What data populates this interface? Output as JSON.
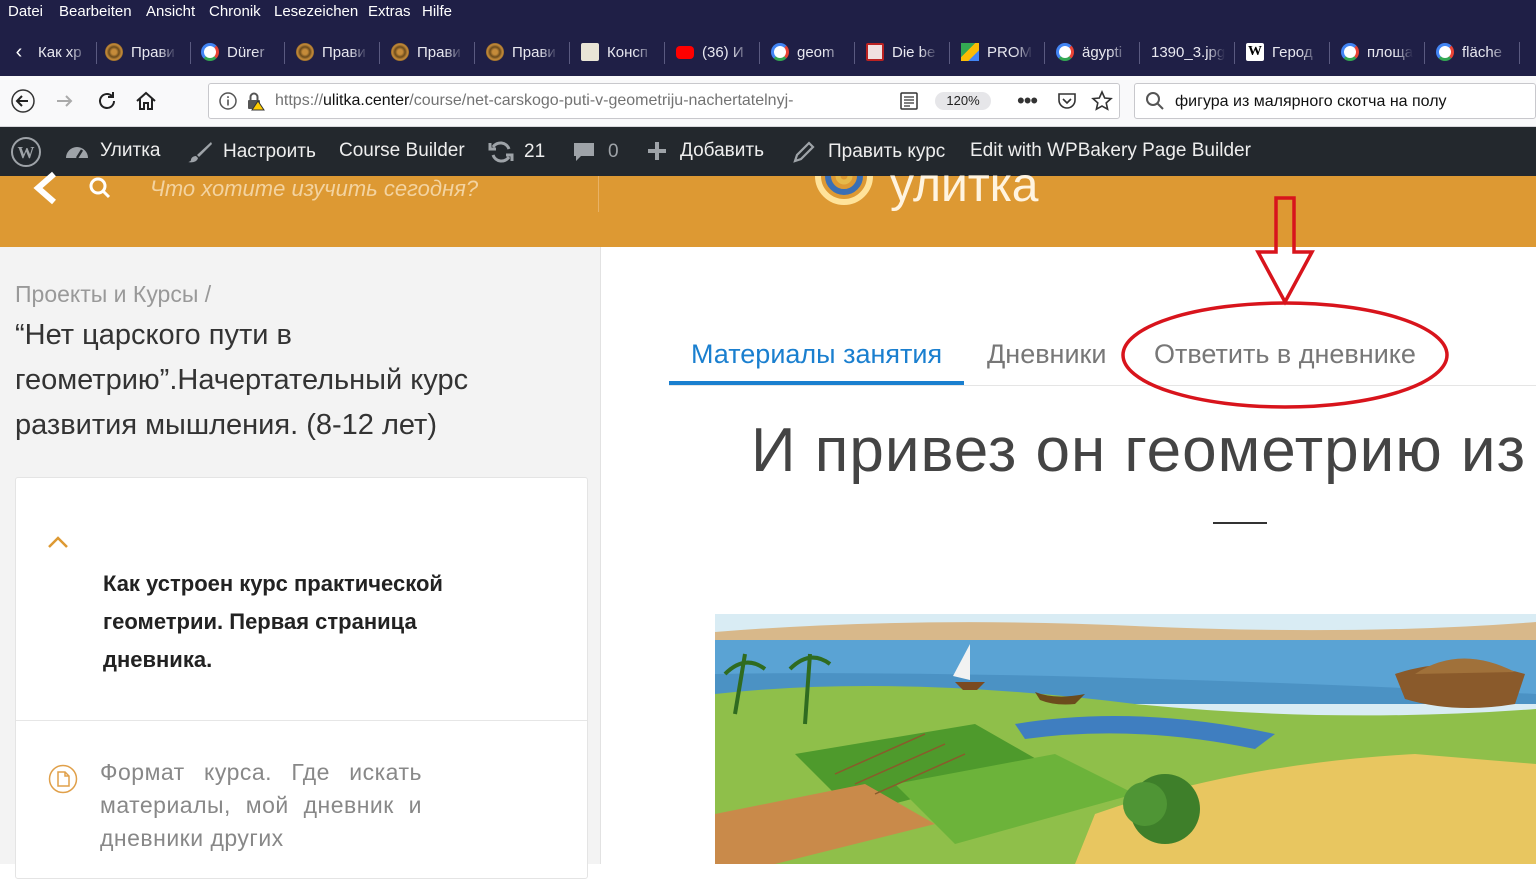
{
  "menu": [
    "Datei",
    "Bearbeiten",
    "Ansicht",
    "Chronik",
    "Lesezeichen",
    "Extras",
    "Hilfe"
  ],
  "tabs": [
    {
      "label": "Как хр",
      "icon": "none"
    },
    {
      "label": "Прави",
      "icon": "snail-icon"
    },
    {
      "label": "Dürer",
      "icon": "google-icon"
    },
    {
      "label": "Прави",
      "icon": "snail-icon"
    },
    {
      "label": "Прави",
      "icon": "snail-icon"
    },
    {
      "label": "Прави",
      "icon": "snail-icon"
    },
    {
      "label": "Консп",
      "icon": "book-icon"
    },
    {
      "label": "(36) И",
      "icon": "youtube-icon"
    },
    {
      "label": "geom",
      "icon": "google-icon"
    },
    {
      "label": "Die be",
      "icon": "page-icon"
    },
    {
      "label": "PROM",
      "icon": "prom-icon"
    },
    {
      "label": "ägypti",
      "icon": "google-icon"
    },
    {
      "label": "1390_3.jpg",
      "icon": "none"
    },
    {
      "label": "Герод",
      "icon": "wikipedia-icon"
    },
    {
      "label": "площа",
      "icon": "google-icon"
    },
    {
      "label": "fläche",
      "icon": "google-icon"
    }
  ],
  "nav": {
    "url_domain": "ulitka.center",
    "url_prefix": "https://",
    "url_path": "/course/net-carskogo-puti-v-geometriju-nachertatelnyj-",
    "zoom": "120%",
    "search_value": "фигура из малярного скотча на полу"
  },
  "wpbar": {
    "site": "Улитка",
    "customize": "Настроить",
    "course_builder": "Course Builder",
    "updates": "21",
    "comments": "0",
    "add": "Добавить",
    "edit_course": "Править курс",
    "wpbakery": "Edit with WPBakery Page Builder"
  },
  "site": {
    "search_placeholder": "Что хотите изучить сегодня?",
    "logo": "улитка"
  },
  "sidebar": {
    "breadcrumb": "Проекты и Курсы /",
    "course_title": "“Нет царского пути в геометрию”.Начертательный курс развития мышления. (8-12 лет)",
    "lesson_active": "Как устроен курс практической геометрии. Первая страница дневника.",
    "lesson_next": "Формат курса. Где искать материалы, мой дневник и дневники других"
  },
  "main": {
    "tabs": [
      "Материалы занятия",
      "Дневники",
      "Ответить в дневнике"
    ],
    "active_tab": "Материалы занятия",
    "heading": "И привез он геометрию из Е"
  },
  "colors": {
    "browser_dark": "#1f1f46",
    "wp_bar": "#23282d",
    "site_orange": "#dd9933",
    "tab_blue": "#1a7fcf",
    "annotation_red": "#d8141c"
  }
}
